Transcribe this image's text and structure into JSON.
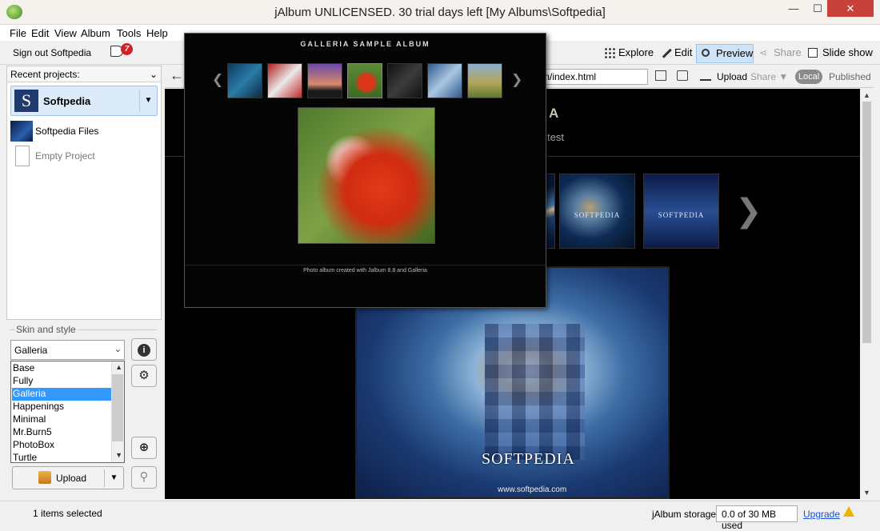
{
  "window": {
    "title": "jAlbum UNLICENSED. 30 trial days left [My Albums\\Softpedia]",
    "min_glyph": "—",
    "max_glyph": "☐",
    "close_glyph": "✕"
  },
  "menu": [
    "File",
    "Edit",
    "View",
    "Album",
    "Tools",
    "Help"
  ],
  "toolbar": {
    "sign_out": "Sign out Softpedia",
    "notification_count": "7",
    "explore": "Explore",
    "edit": "Edit",
    "preview": "Preview",
    "share": "Share",
    "slideshow": "Slide show"
  },
  "left": {
    "recent_label": "Recent projects:",
    "chev": "⌄",
    "main_project": "Softpedia",
    "main_logo": "S",
    "dd_glyph": "▼",
    "projects": [
      "Softpedia Files",
      "Empty Project"
    ]
  },
  "skin": {
    "label": "Skin and style",
    "selected": "Galleria",
    "options": [
      "Base",
      "Fully",
      "Galleria",
      "Happenings",
      "Minimal",
      "Mr.Burn5",
      "PhotoBox",
      "Turtle"
    ],
    "up_glyph": "▲",
    "down_glyph": "▼",
    "info_glyph": "i",
    "gear_glyph": "⚙",
    "zoom_in_glyph": "⊕",
    "search_glyph": "⚲",
    "upload_label": "Upload"
  },
  "addressbar": {
    "back_glyph": "←",
    "url": "m/index.html",
    "upload": "Upload",
    "share": "Share ▼",
    "local": "Local",
    "published": "Published"
  },
  "preview": {
    "title": "A",
    "subtitle": "test",
    "thumb_caption": "SOFTPEDIA",
    "next_glyph": "❯",
    "watermark": "SOFTPEDIA",
    "watermark_url": "www.softpedia.com"
  },
  "popup": {
    "title": "GALLERIA SAMPLE ALBUM",
    "prev_glyph": "❮",
    "next_glyph": "❯",
    "credit": "Photo album created with Jalbum 8.8 and Galleria"
  },
  "status": {
    "selected": "1 items selected",
    "storage_label": "jAlbum storage:",
    "storage_used": "0.0 of 30 MB used",
    "upgrade": "Upgrade"
  },
  "colors": {
    "accent": "#3399ff",
    "close": "#c7413a",
    "link": "#1a53d6"
  }
}
